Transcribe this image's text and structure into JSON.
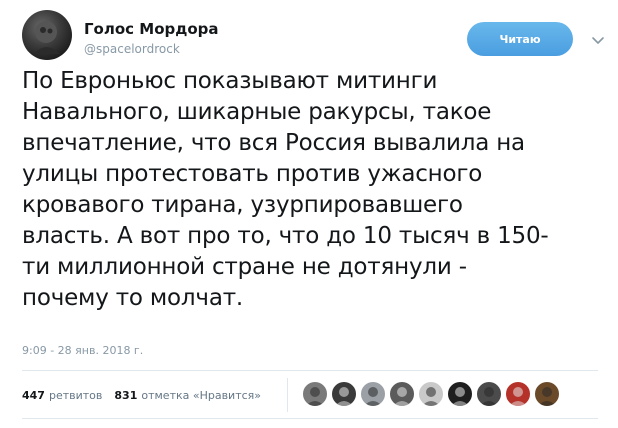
{
  "tweet": {
    "display_name": "Голос Мордора",
    "handle": "@spacelordrock",
    "follow_label": "Читаю",
    "text": "По Евроньюс показывают митинги\nНавального, шикарные ракурсы, такое\nвпечатление, что вся Россия вывалила на\nулицы протестовать против ужасного\nкровавого тирана, узурпировавшего\nвласть. А вот про то, что до 10 тысяч в 150-\nти миллионной стране не дотянули -\nпочему то молчат.",
    "timestamp": "9:09 - 28 янв. 2018 г."
  },
  "stats": {
    "retweets_count": "447",
    "retweets_label": "ретвитов",
    "likes_count": "831",
    "likes_label": "отметка «Нравится»"
  },
  "likers": [
    {
      "icon": "liker-avatar-1",
      "color": "#7a7a7a"
    },
    {
      "icon": "liker-avatar-2",
      "color": "#3a3a3a"
    },
    {
      "icon": "liker-avatar-3",
      "color": "#9aa0a6"
    },
    {
      "icon": "liker-avatar-4",
      "color": "#5b5b5b"
    },
    {
      "icon": "liker-avatar-5",
      "color": "#c9c9c9"
    },
    {
      "icon": "liker-avatar-6",
      "color": "#1f1f1f"
    },
    {
      "icon": "liker-avatar-7",
      "color": "#4b4b4b"
    },
    {
      "icon": "liker-avatar-8",
      "color": "#b5322a"
    },
    {
      "icon": "liker-avatar-9",
      "color": "#6b4a2a"
    }
  ],
  "colors": {
    "accent": "#1da1f2",
    "secondary_text": "#8899a6",
    "primary_text": "#14171a",
    "divider": "#e1e8ed"
  }
}
